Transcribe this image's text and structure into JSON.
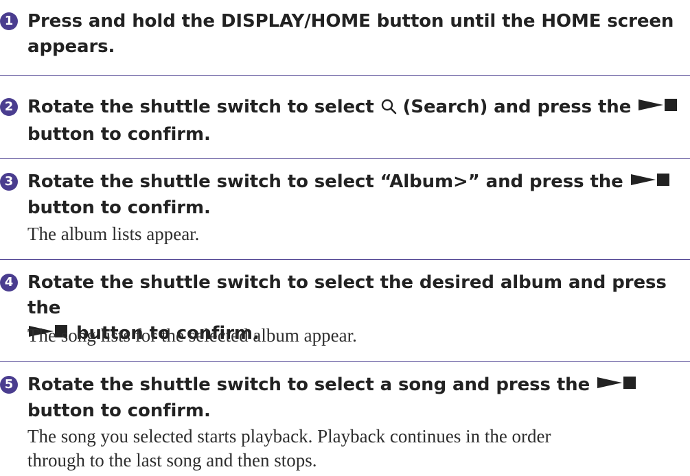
{
  "steps": [
    {
      "number": "1",
      "line1": "Press and hold the DISPLAY/HOME button until the HOME screen",
      "line2": "appears.",
      "body": []
    },
    {
      "number": "2",
      "line1_a": "Rotate the shuttle switch to select ",
      "line1_b": " (Search) and press the ",
      "line2": "button to confirm.",
      "icon": "search-icon",
      "body": []
    },
    {
      "number": "3",
      "line1_a": "Rotate the shuttle switch to select “Album>” and press the ",
      "line2": "button to confirm.",
      "body": [
        "The album lists appear."
      ]
    },
    {
      "number": "4",
      "line1": "Rotate the shuttle switch to select the desired album and press the",
      "line2_b": " button to confirm.",
      "body": [
        "The song lists for the selected album appear."
      ]
    },
    {
      "number": "5",
      "line1_a": "Rotate the shuttle switch to select a song and press the ",
      "line2": "button to confirm.",
      "body": [
        "The song you selected starts playback. Playback continues in the order",
        "through to the last song and then stops."
      ]
    }
  ],
  "colors": {
    "accent": "#4a3d8f",
    "heading": "#222222",
    "body": "#2e2e2e"
  }
}
